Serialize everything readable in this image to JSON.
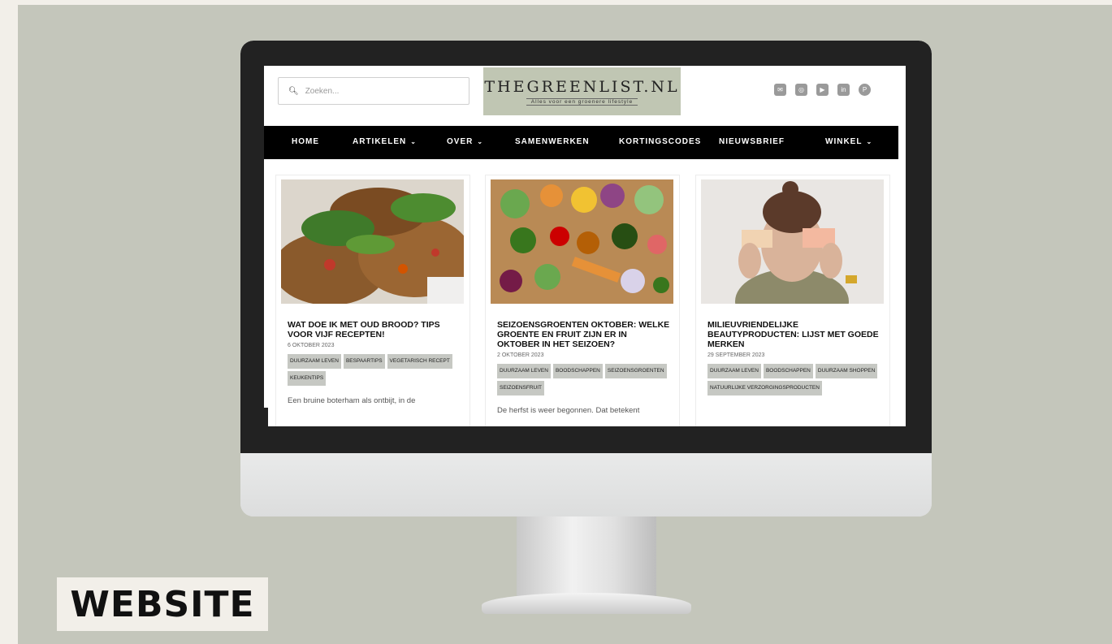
{
  "site": {
    "search_placeholder": "Zoeken...",
    "logo_title": "THEGREENLIST.NL",
    "logo_tagline": "Alles voor een groenere lifestyle",
    "social_icons": [
      "mail-icon",
      "instagram-icon",
      "youtube-icon",
      "linkedin-icon",
      "pinterest-icon"
    ]
  },
  "nav": {
    "items": [
      {
        "label": "HOME",
        "dropdown": false
      },
      {
        "label": "ARTIKELEN",
        "dropdown": true
      },
      {
        "label": "OVER",
        "dropdown": true
      },
      {
        "label": "SAMENWERKEN",
        "dropdown": false
      },
      {
        "label": "KORTINGSCODES",
        "dropdown": false
      },
      {
        "label": "NIEUWSBRIEF",
        "dropdown": false
      },
      {
        "label": "WINKEL",
        "dropdown": true
      }
    ],
    "chevron": "⌄"
  },
  "articles": [
    {
      "title": "WAT DOE IK MET OUD BROOD? TIPS VOOR VIJF RECEPTEN!",
      "date": "6 OKTOBER 2023",
      "tags": [
        "DUURZAAM LEVEN",
        "BESPAARTIPS",
        "VEGETARISCH RECEPT",
        "KEUKENTIPS"
      ],
      "excerpt": "Een bruine boterham als ontbijt, in de"
    },
    {
      "title": "SEIZOENSGROENTEN OKTOBER: WELKE GROENTE EN FRUIT ZIJN ER IN OKTOBER IN HET SEIZOEN?",
      "date": "2 OKTOBER 2023",
      "tags": [
        "DUURZAAM LEVEN",
        "BOODSCHAPPEN",
        "SEIZOENSGROENTEN",
        "SEIZOENSFRUIT"
      ],
      "excerpt": "De herfst is weer begonnen. Dat betekent"
    },
    {
      "title": "MILIEUVRIENDELIJKE BEAUTYPRODUCTEN: LIJST MET GOEDE MERKEN",
      "date": "29 SEPTEMBER 2023",
      "tags": [
        "DUURZAAM LEVEN",
        "BOODSCHAPPEN",
        "DUURZAAM SHOPPEN",
        "NATUURLIJKE VERZORGINGSPRODUCTEN"
      ],
      "excerpt": ""
    }
  ],
  "caption": "WEBSITE"
}
